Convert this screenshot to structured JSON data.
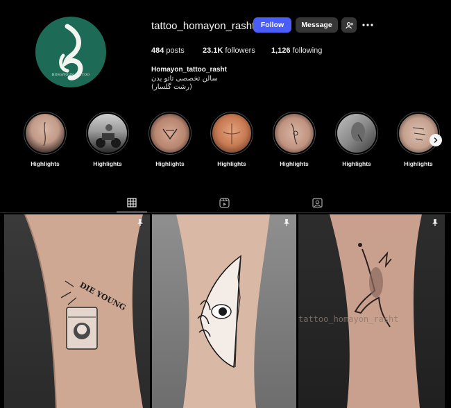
{
  "profile": {
    "username": "tattoo_homayon_rasht",
    "follow_label": "Follow",
    "message_label": "Message",
    "avatar_caption": "HOMAYOUN TATTOO",
    "stats": {
      "posts_value": "484",
      "posts_label": "posts",
      "followers_value": "23.1K",
      "followers_label": "followers",
      "following_value": "1,126",
      "following_label": "following"
    },
    "full_name": "Homayon_tattoo_rasht",
    "bio_line1": "سالن تخصصی تاتو بدن",
    "bio_line2": "(رشت گلسار)"
  },
  "highlights": [
    {
      "label": "Highlights"
    },
    {
      "label": "Highlights"
    },
    {
      "label": "Highlights"
    },
    {
      "label": "Highlights"
    },
    {
      "label": "Highlights"
    },
    {
      "label": "Highlights"
    },
    {
      "label": "Highlights"
    }
  ],
  "tabs": [
    "posts-grid",
    "reels",
    "tagged"
  ],
  "posts": [
    {
      "tattoo_text": "DIE YOUNG",
      "pinned": true
    },
    {
      "pinned": true
    },
    {
      "watermark": "tattoo_homayon_rasht",
      "pinned": true
    }
  ],
  "colors": {
    "accent": "#4a5df9",
    "avatar_bg": "#1d6b56",
    "button_bg": "#363636"
  }
}
